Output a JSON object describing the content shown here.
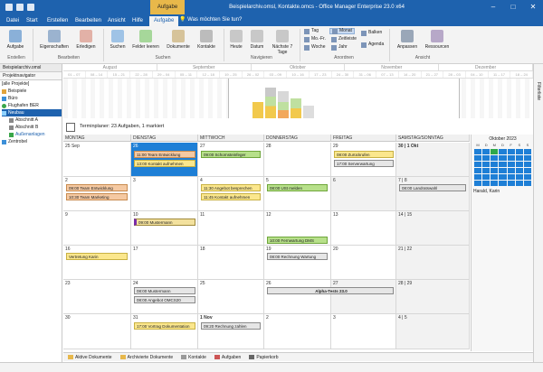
{
  "titlebar": {
    "context_tab": "Aufgabe",
    "title": "Beispielarchiv.omsl, Kontakte.omcs - Office Manager Enterprise 23.0 x64",
    "minimize": "–",
    "maximize": "□",
    "close": "✕"
  },
  "tabs": [
    "Datei",
    "Start",
    "Erstellen",
    "Bearbeiten",
    "Ansicht",
    "Hilfe",
    "Aufgabe"
  ],
  "tellme": "Was möchten Sie tun?",
  "ribbon": {
    "erstellen": {
      "button": "Aufgabe",
      "group": "Erstellen"
    },
    "bearbeiten": {
      "eigenschaften": "Eigenschaften",
      "erledigen": "Erledigen",
      "group": "Bearbeiten"
    },
    "suchen": {
      "suchen": "Suchen",
      "felder_leeren": "Felder leeren",
      "dokumente": "Dokumente",
      "kontakte": "Kontakte",
      "group": "Suchen"
    },
    "navigieren": {
      "heute": "Heute",
      "datum": "Datum",
      "naechste": "Nächste 7 Tage",
      "group": "Navigieren"
    },
    "anordnen": {
      "tag": "Tag",
      "mofr": "Mo.-Fr.",
      "woche": "Woche",
      "monat": "Monat",
      "zeitleiste": "Zeitleiste",
      "jahr": "Jahr",
      "balken": "Balken",
      "agenda": "Agenda",
      "group": "Anordnen"
    },
    "ansicht": {
      "anpassen": "Anpassen",
      "ressourcen": "Ressourcen",
      "group": "Ansicht"
    }
  },
  "left_panel": {
    "archive": "Beispielarchiv.omsl",
    "navigator": "Projektnavigator",
    "items": [
      "[alle Projekte]",
      "Beispiele",
      "Büro",
      "Flughafen BER",
      "Neubau",
      "Abschnitt A",
      "Abschnitt B",
      "Außenanlagen",
      "Zentrobel"
    ]
  },
  "right_strip": {
    "label": "Filterliste"
  },
  "timeline": {
    "months": [
      "August",
      "September",
      "Oktober",
      "November",
      "Dezember"
    ],
    "weeks": [
      "01 – 07",
      "08 – 14",
      "15 – 21",
      "22 – 28",
      "29 – 04",
      "05 – 11",
      "12 – 18",
      "19 – 25",
      "26 – 02",
      "03 – 09",
      "10 – 16",
      "17 – 23",
      "24 – 30",
      "31 – 06",
      "07 – 13",
      "14 – 20",
      "21 – 27",
      "28 – 03",
      "04 – 10",
      "11 – 17",
      "18 – 24"
    ]
  },
  "scheduler": {
    "title": "Terminplaner: 23 Aufgaben, 1 markiert"
  },
  "days": [
    "MONTAG",
    "DIENSTAG",
    "MITTWOCH",
    "DONNERSTAG",
    "FREITAG",
    "SAMSTAG/SONNTAG"
  ],
  "weeks": [
    [
      "25 Sep",
      "26",
      "27",
      "28",
      "29",
      "30 | 1 Okt"
    ],
    [
      "2",
      "3",
      "4",
      "5",
      "6",
      "7 | 8"
    ],
    [
      "9",
      "10",
      "11",
      "12",
      "13",
      "14 | 15"
    ],
    [
      "16",
      "17",
      "18",
      "19",
      "20",
      "21 | 22"
    ],
    [
      "23",
      "24",
      "25",
      "26",
      "27",
      "28 | 29"
    ],
    [
      "30",
      "31",
      "1 Nov",
      "2",
      "3",
      "4 | 5"
    ]
  ],
  "appointments": {
    "a1": "11:00 Team Entwicklung",
    "a2": "13:00 Kontakt aufnehmen",
    "a3": "09:00 Schornsteinfeger",
    "a4": "08:00 Zurückrufen",
    "a5": "17:00 Serverwartung",
    "a6": "09:00 Team Entwicklung",
    "a7": "10:30 Team Marketing",
    "a8": "11:30 Angebot besprechen",
    "a9": "11:45 Kontakt aufnehmen",
    "a10": "08:00 USt melden",
    "a11": "08:00 Landratswahl",
    "a12": "09:00 Mustermann",
    "a13": "10:00 Fernwartung DMS",
    "a14": "Vertretung Karin",
    "a15": "08:00 Rechnung Wartung",
    "a16": "Alpha-Tests 23.0",
    "a17": "08:00 Mustermann",
    "a18": "08:00 Angebot OMCS20",
    "a19": "17:00 Vortrag Dokumentation",
    "a20": "09:20 Rechnung zahlen"
  },
  "minical": {
    "title": "Oktober 2023",
    "weekday_headers": [
      "M",
      "D",
      "M",
      "D",
      "F",
      "S",
      "S"
    ],
    "resource_label": "Harald, Karin"
  },
  "bottom_tabs": [
    "Aktive Dokumente",
    "Archivierte Dokumente",
    "Kontakte",
    "Aufgaben",
    "Papierkorb"
  ],
  "colors": {
    "titlebar": "#1e62ae",
    "today": "#1e7fd6",
    "context_tab": "#e8b84a"
  }
}
